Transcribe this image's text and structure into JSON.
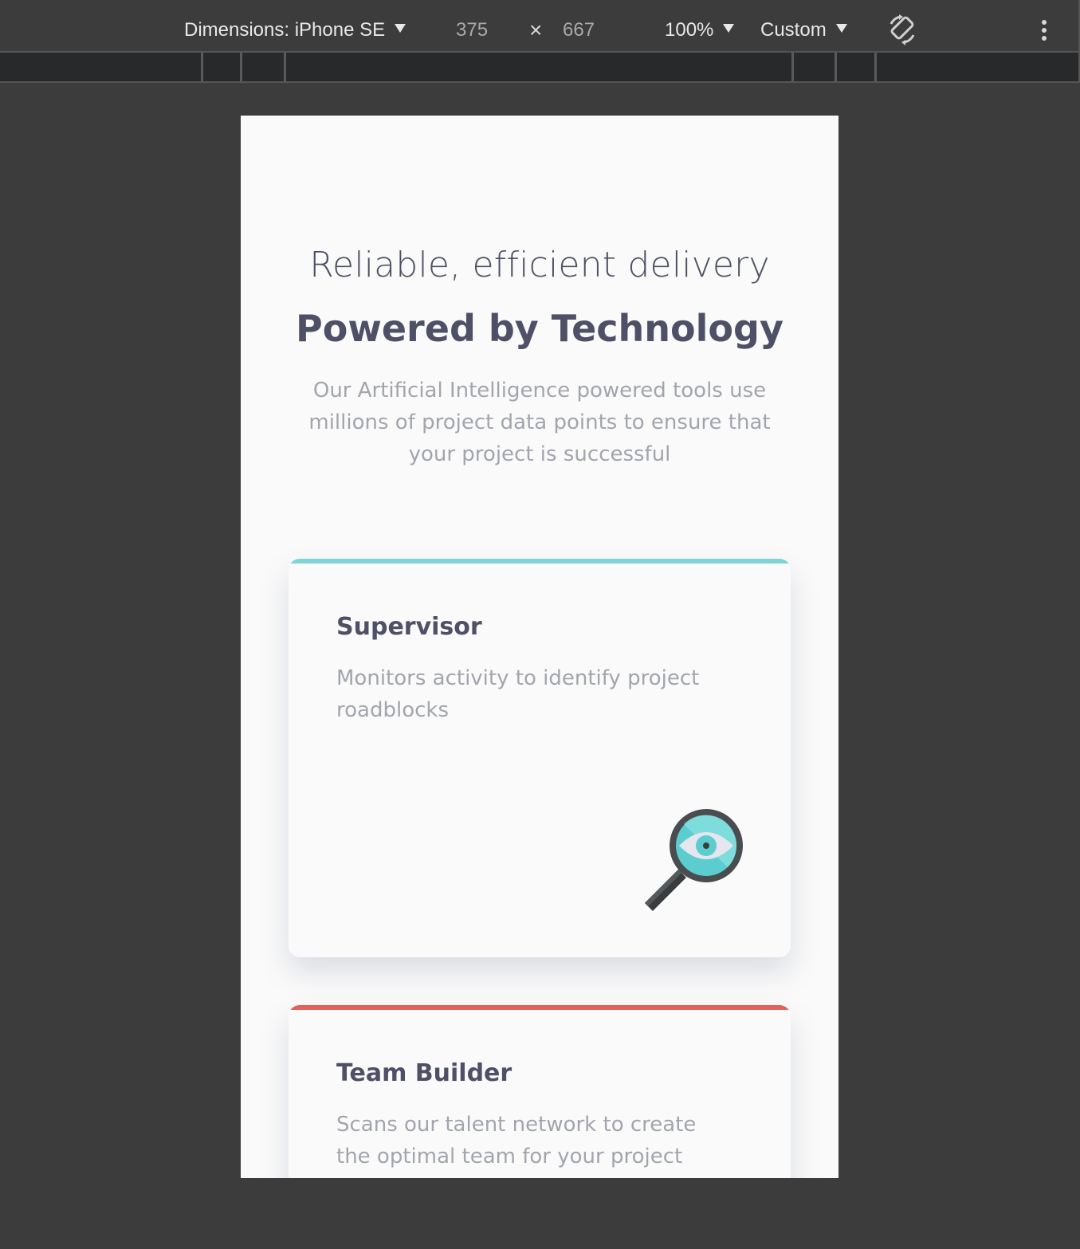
{
  "devtools": {
    "device_label": "Dimensions: iPhone SE",
    "width": "375",
    "times_symbol": "×",
    "height": "667",
    "zoom": "100%",
    "throttle": "Custom",
    "icons": [
      "caret-down-icon",
      "rotate-icon",
      "more-vert-icon"
    ]
  },
  "page": {
    "eyebrow": "Reliable, efficient delivery",
    "headline": "Powered by Technology",
    "lead": "Our Artificial Intelligence powered tools use millions of project data points to ensure that your project is successful",
    "cards": [
      {
        "title": "Supervisor",
        "description": "Monitors activity to identify project roadblocks",
        "accent": "#7fd5d6",
        "icon": "magnifier-eye-icon"
      },
      {
        "title": "Team Builder",
        "description": "Scans our talent network to create the optimal team for your project",
        "accent": "#e06258"
      }
    ]
  },
  "colors": {
    "text_dark": "#4d5066",
    "text_muted": "#a3a5ae",
    "page_bg": "#fafafa",
    "devtools_bg": "#3c3c3c"
  }
}
